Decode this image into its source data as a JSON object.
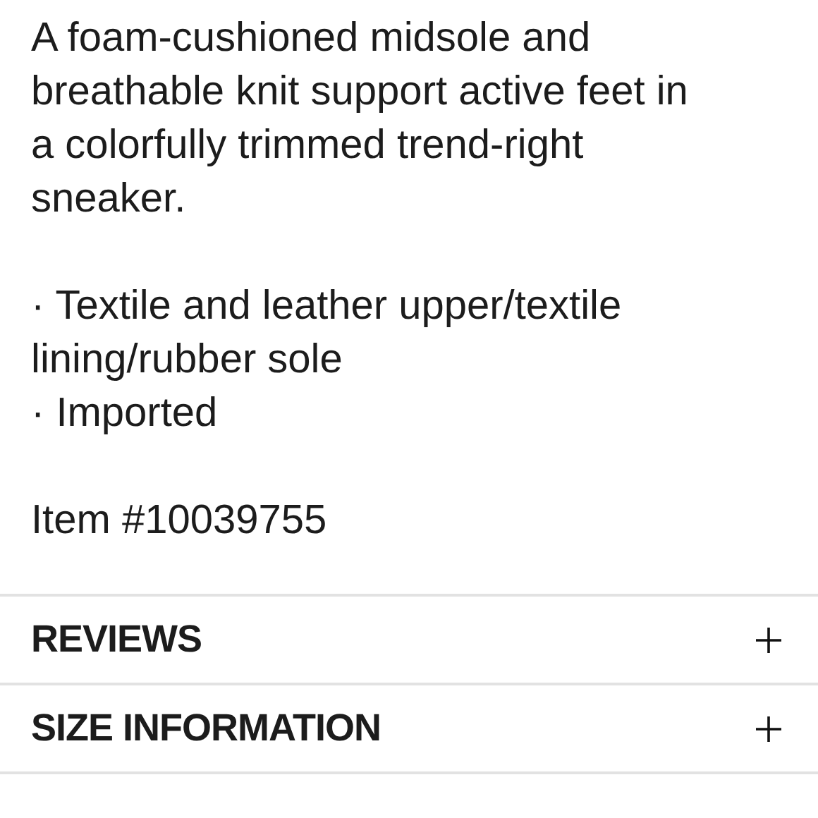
{
  "description": "A foam-cushioned midsole and breathable knit support active feet in a colorfully trimmed trend-right sneaker.",
  "features": [
    "· Textile and leather upper/textile lining/rubber sole",
    "· Imported"
  ],
  "item_number": "Item #10039755",
  "sections": [
    {
      "label": "REVIEWS",
      "expanded": false
    },
    {
      "label": "SIZE INFORMATION",
      "expanded": false
    }
  ]
}
